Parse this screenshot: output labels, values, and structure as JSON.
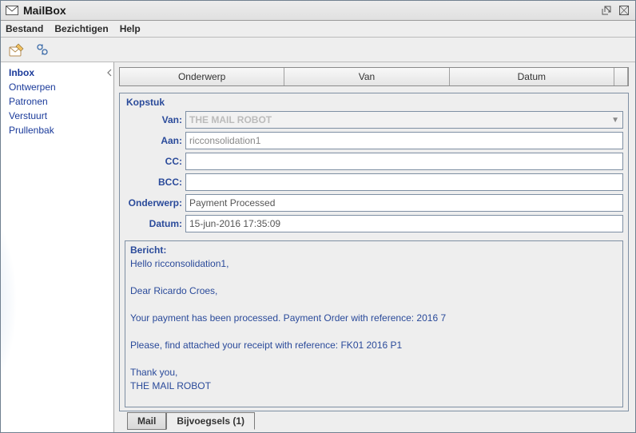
{
  "window": {
    "title": "MailBox"
  },
  "menubar": {
    "items": [
      "Bestand",
      "Bezichtigen",
      "Help"
    ]
  },
  "sidebar": {
    "folders": [
      "Inbox",
      "Ontwerpen",
      "Patronen",
      "Verstuurt",
      "Prullenbak"
    ],
    "selected_index": 0
  },
  "list": {
    "headers": [
      "Onderwerp",
      "Van",
      "Datum"
    ]
  },
  "composer": {
    "group_title": "Kopstuk",
    "labels": {
      "from": "Van:",
      "to": "Aan:",
      "cc": "CC:",
      "bcc": "BCC:",
      "subject": "Onderwerp:",
      "date": "Datum:"
    },
    "from": "THE MAIL ROBOT",
    "to": "ricconsolidation1",
    "cc": "",
    "bcc": "",
    "subject": "Payment Processed",
    "date": "15-jun-2016 17:35:09"
  },
  "message": {
    "label": "Bericht:",
    "body": "Hello  ricconsolidation1,\n\nDear Ricardo Croes,\n\nYour payment has been processed. Payment Order with reference: 2016 7\n\nPlease, find attached your receipt with reference: FK01 2016 P1\n\nThank you,\nTHE MAIL ROBOT"
  },
  "tabs": {
    "items": [
      "Mail",
      "Bijvoegsels (1)"
    ],
    "active_index": 1
  }
}
